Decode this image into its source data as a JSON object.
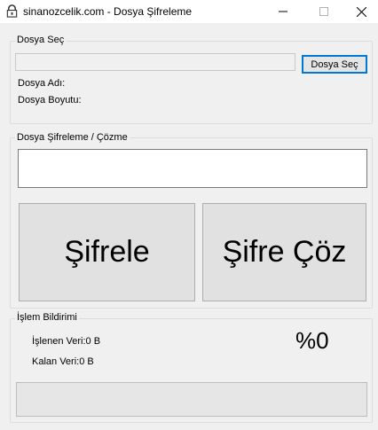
{
  "window": {
    "title": "sinanozcelik.com - Dosya Şifreleme",
    "icon": "lock-icon"
  },
  "file_group": {
    "legend": "Dosya Seç",
    "path_value": "",
    "select_button": "Dosya Seç",
    "file_name_label": "Dosya Adı:",
    "file_name_value": "",
    "file_size_label": "Dosya Boyutu:",
    "file_size_value": ""
  },
  "crypto_group": {
    "legend": "Dosya Şifreleme / Çözme",
    "password_value": "",
    "encrypt_button": "Şifrele",
    "decrypt_button": "Şifre Çöz"
  },
  "status_group": {
    "legend": "İşlem Bildirimi",
    "processed_label": "İşlenen Veri:0 B",
    "remaining_label": "Kalan Veri:0 B",
    "percent": "%0",
    "progress_fraction": 0
  }
}
